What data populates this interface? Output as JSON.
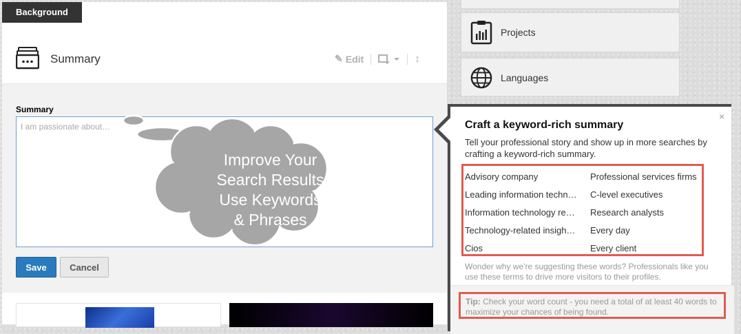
{
  "left": {
    "tab_label": "Background",
    "section_title": "Summary",
    "edit_label": "Edit",
    "field_label": "Summary",
    "placeholder": "I am passionate about…",
    "save_label": "Save",
    "cancel_label": "Cancel"
  },
  "right": {
    "projects_label": "Projects",
    "languages_label": "Languages"
  },
  "cloud": {
    "lines": [
      "Improve Your",
      "Search Results",
      "Use Keywords",
      "& Phrases"
    ],
    "color": "#a6a6a6"
  },
  "popover": {
    "close": "×",
    "title": "Craft a keyword-rich summary",
    "description": "Tell your professional story and show up in more searches by crafting a keyword-rich summary.",
    "keywords_left": [
      "Advisory company",
      "Leading information techn…",
      "Information technology re…",
      "Technology-related insigh…",
      "Cios"
    ],
    "keywords_right": [
      "Professional services firms",
      "C-level executives",
      "Research analysts",
      "Every day",
      "Every client"
    ],
    "wonder": "Wonder why we're suggesting these words? Professionals like you use these terms to drive more visitors to their profiles.",
    "tip_label": "Tip:",
    "tip_text": "Check your word count - you need a total of at least 40 words to maximize your chances of being found."
  },
  "colors": {
    "primary_button": "#2a7bbe",
    "highlight_box": "#e35a4f",
    "tab_background": "#333333"
  }
}
